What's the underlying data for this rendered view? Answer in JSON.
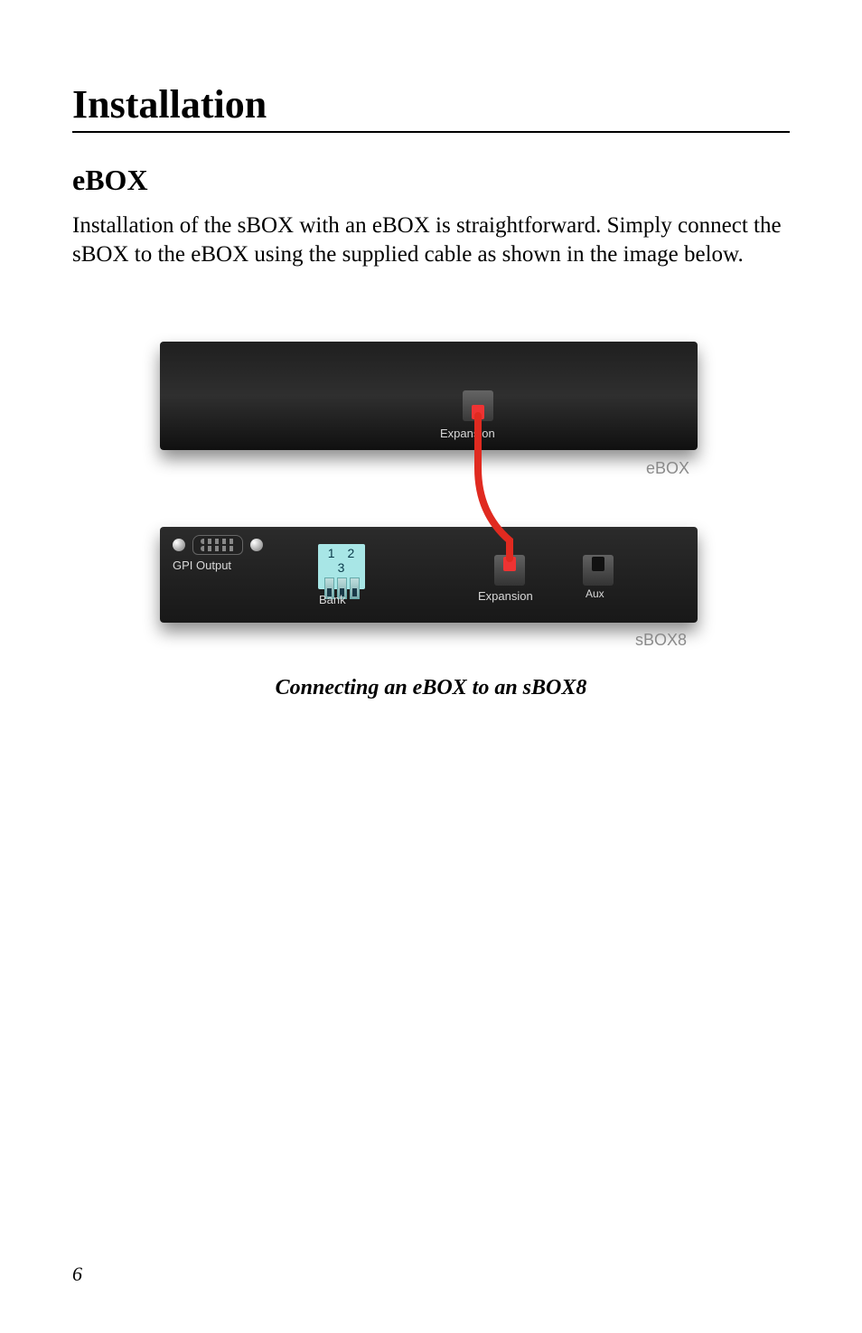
{
  "headings": {
    "h1": "Installation",
    "h2": "eBOX"
  },
  "paragraph": "Installation of the sBOX with an eBOX is straightforward.  Simply connect the sBOX to the eBOX using the supplied cable as shown in the image below.",
  "diagram": {
    "ebox": {
      "port_label": "Expansion",
      "name": "eBOX"
    },
    "sbox": {
      "gpi_label": "GPI Output",
      "bank_nums": "1 2 3",
      "bank_label": "Bank",
      "expansion_label": "Expansion",
      "aux_label": "Aux",
      "name": "sBOX8"
    },
    "caption": "Connecting an eBOX to an sBOX8"
  },
  "page_number": "6"
}
